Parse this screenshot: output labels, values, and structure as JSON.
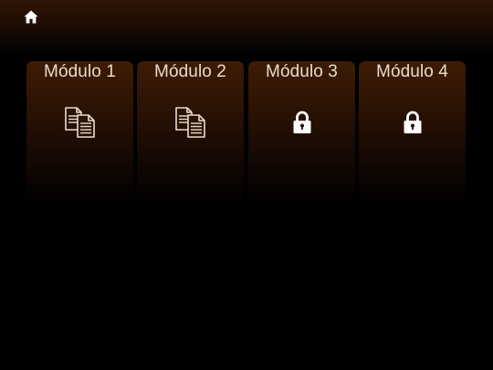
{
  "nav": {
    "home_icon": "home-icon"
  },
  "modules": [
    {
      "title": "Módulo 1",
      "icon": "documents-icon",
      "locked": false
    },
    {
      "title": "Módulo 2",
      "icon": "documents-icon",
      "locked": false
    },
    {
      "title": "Módulo 3",
      "icon": "lock-icon",
      "locked": true
    },
    {
      "title": "Módulo 4",
      "icon": "lock-icon",
      "locked": true
    }
  ],
  "colors": {
    "background": "#000000",
    "card_top": "#3e1c05",
    "title_text": "#e9dccd",
    "icon_color": "#ffffff"
  }
}
